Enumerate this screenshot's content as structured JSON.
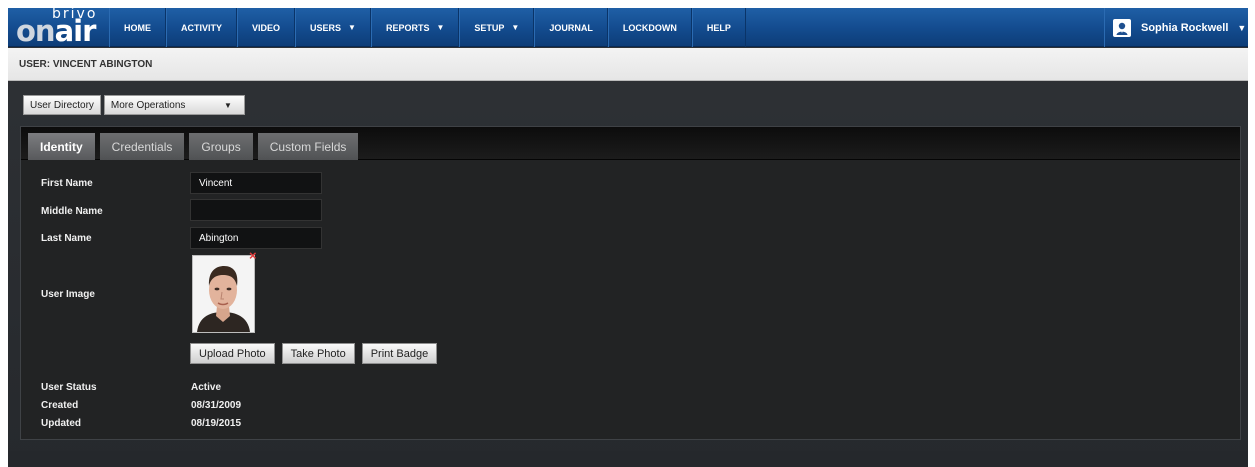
{
  "logo": {
    "top": "brivo",
    "on": "on",
    "air": "air"
  },
  "nav": {
    "items": [
      {
        "label": "HOME",
        "caret": ""
      },
      {
        "label": "ACTIVITY",
        "caret": ""
      },
      {
        "label": "VIDEO",
        "caret": ""
      },
      {
        "label": "USERS",
        "caret": "▼"
      },
      {
        "label": "REPORTS",
        "caret": "▼"
      },
      {
        "label": "SETUP",
        "caret": "▼"
      },
      {
        "label": "JOURNAL",
        "caret": ""
      },
      {
        "label": "LOCKDOWN",
        "caret": ""
      },
      {
        "label": "HELP",
        "caret": ""
      }
    ],
    "user_name": "Sophia Rockwell",
    "user_caret": "▼"
  },
  "page": {
    "title": "USER: VINCENT ABINGTON"
  },
  "operations": {
    "user_directory": "User Directory",
    "more_operations": "More Operations",
    "more_caret": "▼"
  },
  "tabs": [
    {
      "label": "Identity",
      "active": true
    },
    {
      "label": "Credentials",
      "active": false
    },
    {
      "label": "Groups",
      "active": false
    },
    {
      "label": "Custom Fields",
      "active": false
    }
  ],
  "identity": {
    "first_name_label": "First Name",
    "first_name": "Vincent",
    "middle_name_label": "Middle Name",
    "middle_name": "",
    "last_name_label": "Last Name",
    "last_name": "Abington",
    "user_image_label": "User Image",
    "remove_photo": "×",
    "upload_photo": "Upload Photo",
    "take_photo": "Take Photo",
    "print_badge": "Print Badge",
    "status_label": "User Status",
    "status": "Active",
    "created_label": "Created",
    "created": "08/31/2009",
    "updated_label": "Updated",
    "updated": "08/19/2015"
  },
  "colors": {
    "nav_blue": "#134b8e",
    "panel_bg": "#222324",
    "remove_red": "#e23b3b"
  }
}
